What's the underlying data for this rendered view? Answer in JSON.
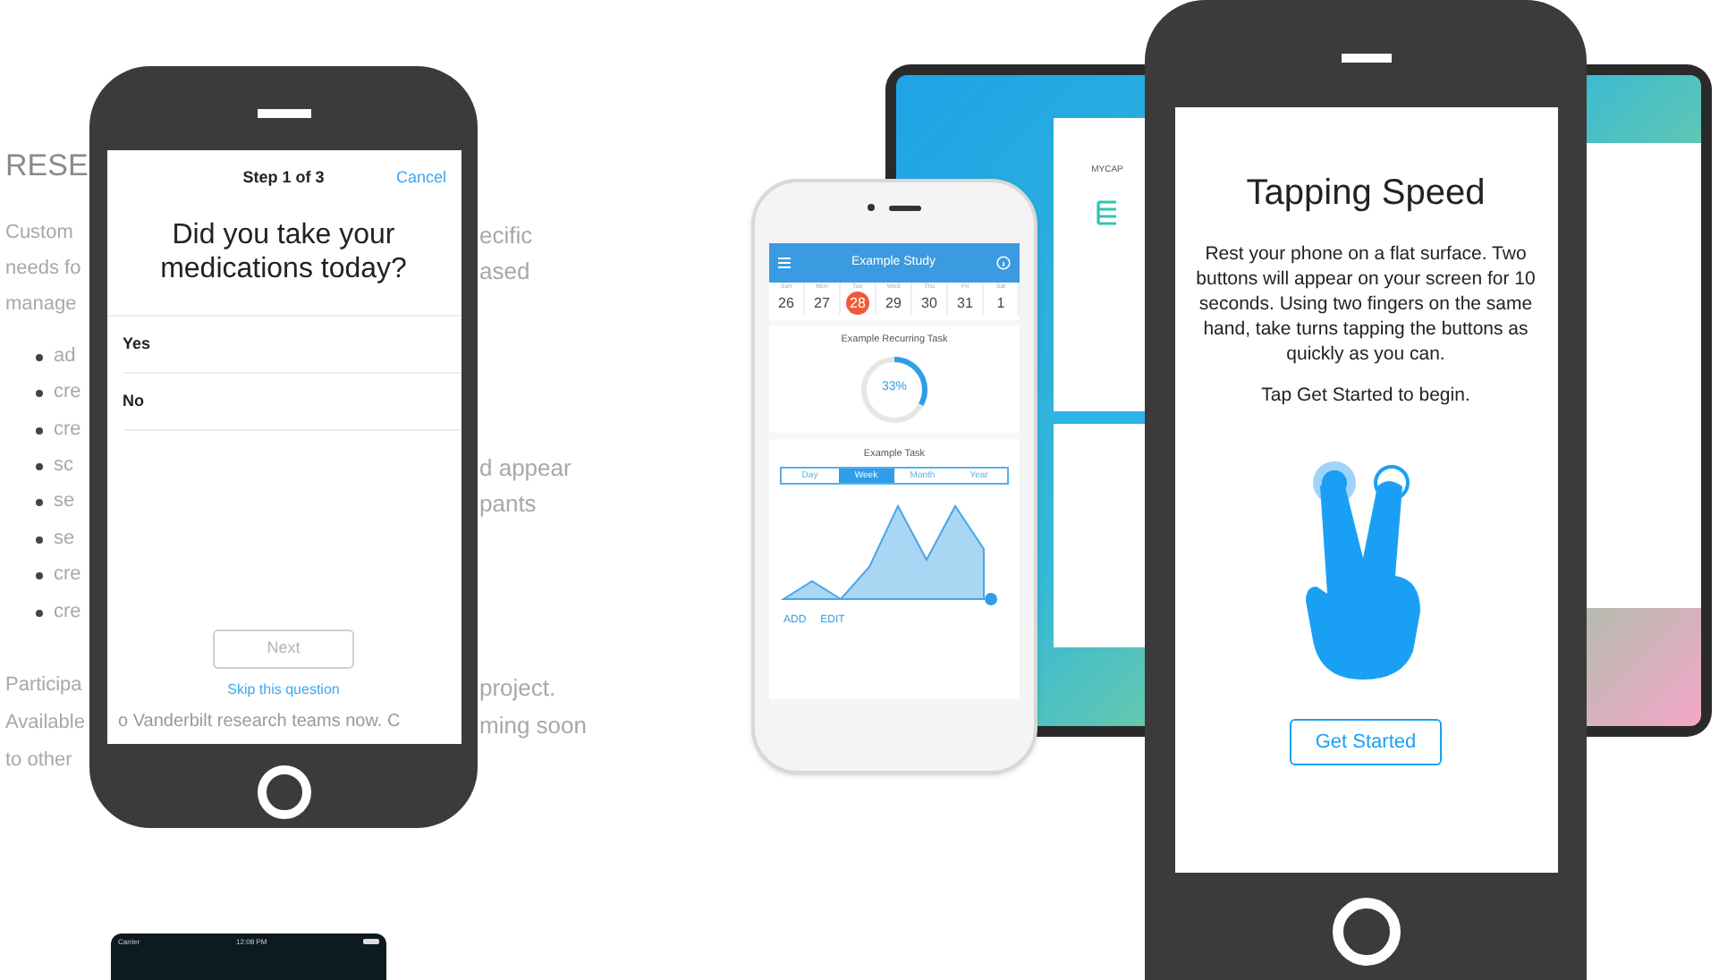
{
  "article": {
    "heading": "RESE",
    "intro_lines": [
      {
        "left": "Custom",
        "right": "ecific"
      },
      {
        "left": "needs fo",
        "right": "ased"
      },
      {
        "left": "manage"
      }
    ],
    "bullets": [
      {
        "left": "ad"
      },
      {
        "left": "cre"
      },
      {
        "left": "cre"
      },
      {
        "left": "sc",
        "right": "d appear"
      },
      {
        "left": "se",
        "right": "pants"
      },
      {
        "left": "se"
      },
      {
        "left": "cre"
      },
      {
        "left": "cre"
      }
    ],
    "closing_lines": [
      {
        "left": "Participa",
        "right": "project."
      },
      {
        "left": "Available",
        "middle": "o Vanderbilt research teams now. C",
        "right": "ming soon"
      },
      {
        "left": "to other"
      }
    ]
  },
  "survey_phone": {
    "step": "Step 1 of 3",
    "cancel": "Cancel",
    "question": "Did you take your medications today?",
    "options": [
      {
        "label": "Yes",
        "selected": false
      },
      {
        "label": "No",
        "selected": false
      }
    ],
    "next_button": {
      "label": "Next",
      "disabled": true
    },
    "skip_link": "Skip this question"
  },
  "study_phone": {
    "title": "Example Study",
    "days": [
      {
        "weekday": "Sun",
        "date": "26",
        "selected": false
      },
      {
        "weekday": "Mon",
        "date": "27",
        "selected": false
      },
      {
        "weekday": "Tue",
        "date": "28",
        "selected": true
      },
      {
        "weekday": "Wed",
        "date": "29",
        "selected": false
      },
      {
        "weekday": "Thu",
        "date": "30",
        "selected": false
      },
      {
        "weekday": "Fri",
        "date": "31",
        "selected": false
      },
      {
        "weekday": "Sat",
        "date": "1",
        "selected": false
      }
    ],
    "recurring_task": {
      "title": "Example Recurring Task",
      "level": 0.33,
      "reading": "33%"
    },
    "task": {
      "title": "Example Task",
      "segments": [
        {
          "label": "Day",
          "selected": false
        },
        {
          "label": "Week",
          "selected": true
        },
        {
          "label": "Month",
          "selected": false
        },
        {
          "label": "Year",
          "selected": false
        }
      ]
    },
    "actions": [
      "ADD",
      "EDIT"
    ]
  },
  "laptop": {
    "app_name": "MYCAP"
  },
  "tapping_phone": {
    "title": "Tapping Speed",
    "description": "Rest your phone on a flat surface. Two buttons will appear on your screen for 10 seconds. Using two fingers on the same hand, take turns tapping the buttons as quickly as you can.",
    "hint": "Tap Get Started to begin.",
    "button": "Get Started"
  },
  "small_phone": {
    "carrier": "Carrier",
    "time": "12:08 PM"
  }
}
